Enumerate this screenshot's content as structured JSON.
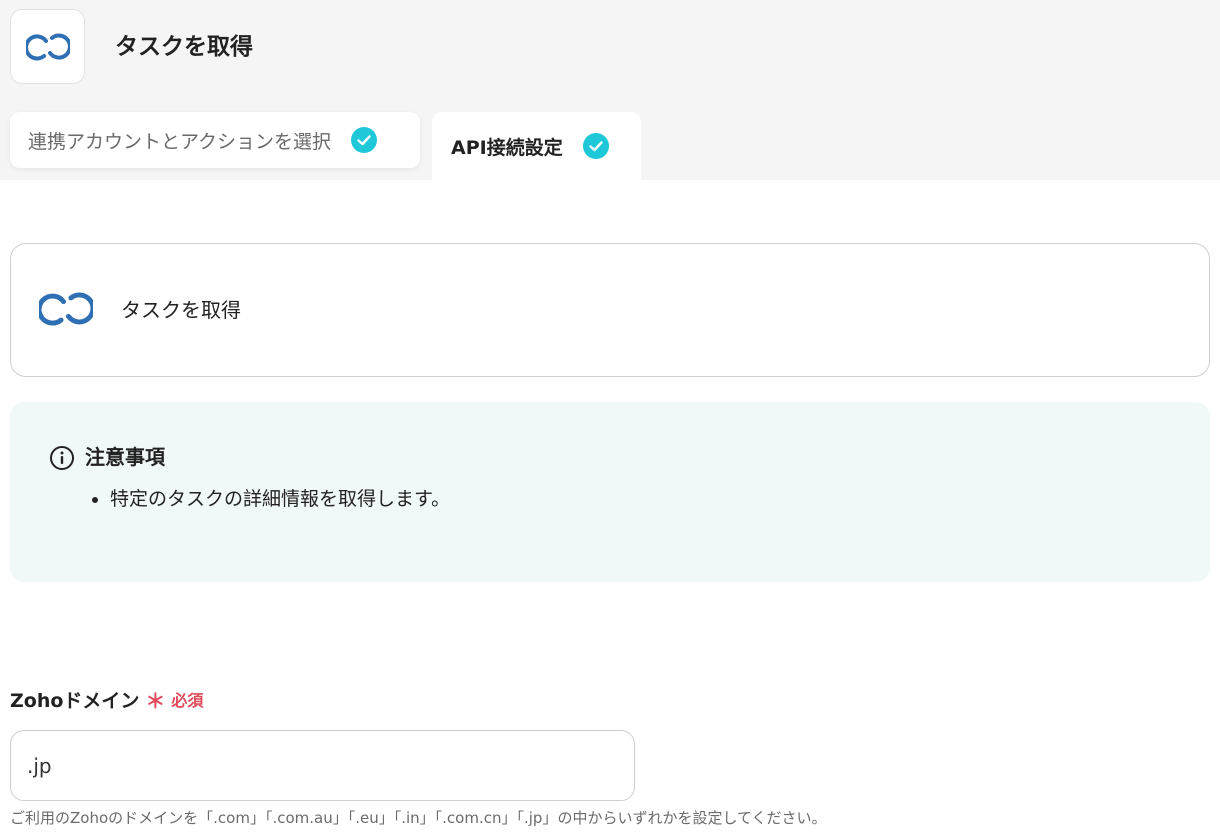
{
  "header": {
    "title": "タスクを取得",
    "app_icon": "zoho-link-icon"
  },
  "tabs": [
    {
      "label": "連携アカウントとアクションを選択",
      "completed": true
    },
    {
      "label": "API接続設定",
      "completed": true
    }
  ],
  "action_card": {
    "title": "タスクを取得",
    "icon": "zoho-link-icon"
  },
  "notice": {
    "title": "注意事項",
    "icon": "info-icon",
    "items": [
      "特定のタスクの詳細情報を取得します。"
    ]
  },
  "form": {
    "zoho_domain": {
      "label": "Zohoドメイン",
      "required_mark": "＊",
      "required_text": "必須",
      "value": ".jp",
      "help": "ご利用のZohoのドメインを「.com」「.com.au」「.eu」「.in」「.com.cn」「.jp」の中からいずれかを設定してください。"
    }
  },
  "colors": {
    "accent_check": "#1ec8d8",
    "zoho_blue": "#2f6fb3",
    "required": "#e04a5b",
    "notice_bg": "#f1f9f8"
  }
}
